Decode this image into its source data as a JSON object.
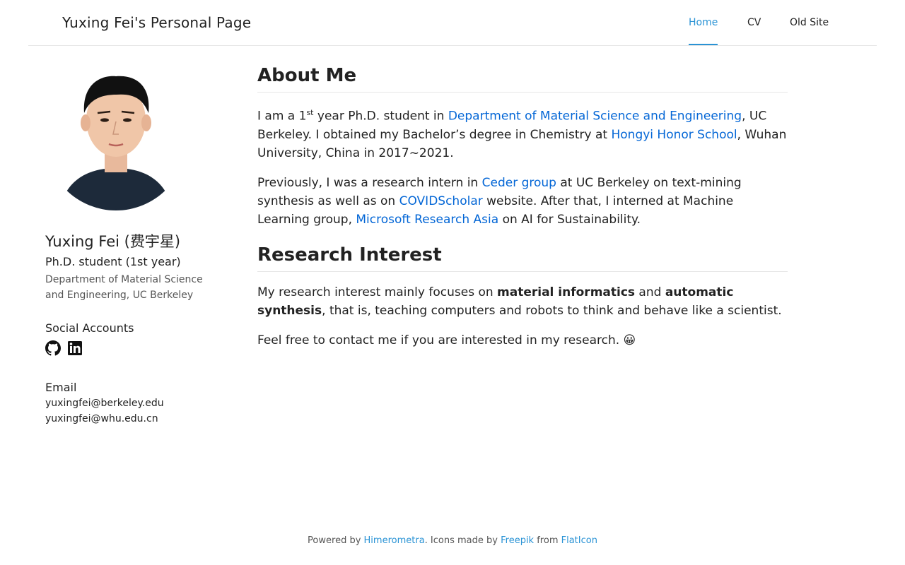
{
  "navbar": {
    "brand": "Yuxing Fei's Personal Page",
    "links": [
      {
        "label": "Home",
        "active": true
      },
      {
        "label": "CV",
        "active": false
      },
      {
        "label": "Old Site",
        "active": false
      }
    ]
  },
  "sidebar": {
    "name": "Yuxing Fei (费宇星)",
    "role": "Ph.D. student (1st year)",
    "affiliation": "Department of Material Science and Engineering, UC Berkeley",
    "social_heading": "Social Accounts",
    "social_icons": [
      "github-icon",
      "linkedin-icon"
    ],
    "email_heading": "Email",
    "emails": [
      "yuxingfei@berkeley.edu",
      "yuxingfei@whu.edu.cn"
    ]
  },
  "about": {
    "heading": "About Me",
    "p1": {
      "t1": "I am a 1",
      "sup": "st",
      "t2": " year Ph.D. student in ",
      "link1": "Department of Material Science and Engineering",
      "t3": ", UC Berkeley. I obtained my Bachelor’s degree in Chemistry at ",
      "link2": "Hongyi Honor School",
      "t4": ", Wuhan University, China in 2017~2021."
    },
    "p2": {
      "t1": "Previously, I was a research intern in ",
      "link1": "Ceder group",
      "t2": " at UC Berkeley on text-mining synthesis as well as on ",
      "link2": "COVIDScholar",
      "t3": " website. After that, I interned at Machine Learning group, ",
      "link3": "Microsoft Research Asia",
      "t4": " on AI for Sustainability."
    }
  },
  "research": {
    "heading": "Research Interest",
    "p1": {
      "t1": "My research interest mainly focuses on ",
      "b1": "material informatics",
      "t2": " and ",
      "b2": "automatic synthesis",
      "t3": ", that is, teaching computers and robots to think and behave like a scientist."
    },
    "p2": "Feel free to contact me if you are interested in my research. 😀"
  },
  "footer": {
    "t1": "Powered by ",
    "link1": "Himerometra",
    "t2": ". Icons made by ",
    "link2": "Freepik",
    "t3": " from ",
    "link3": "FlatIcon"
  },
  "colors": {
    "link": "#0366d6",
    "accent": "#2a93d5",
    "text": "#222222"
  }
}
